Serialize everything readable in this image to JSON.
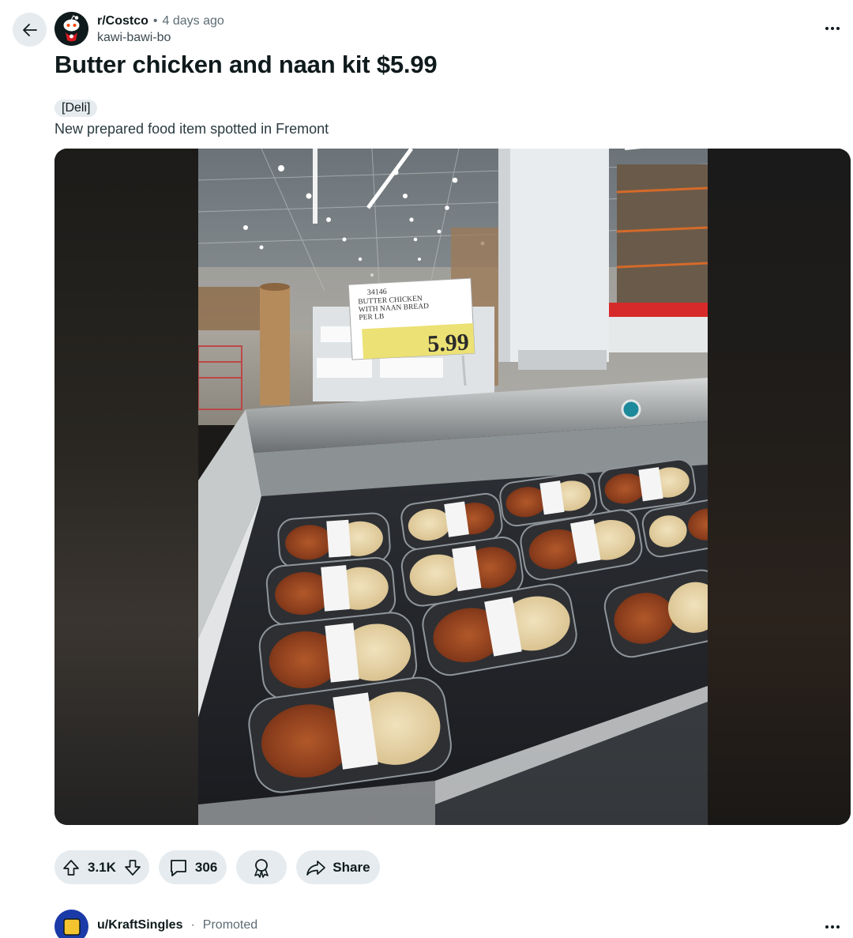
{
  "post": {
    "subreddit": "r/Costco",
    "separator": "•",
    "time_ago": "4 days ago",
    "author": "kawi-bawi-bo",
    "title": "Butter chicken and naan kit $5.99",
    "flair": "[Deli]",
    "body": "New prepared food item spotted in Fremont"
  },
  "media": {
    "sign_item_number": "34146",
    "sign_line1": "BUTTER CHICKEN",
    "sign_line2": "WITH NAAN BREAD",
    "sign_line3": "PER LB",
    "sign_price": "5.99"
  },
  "actions": {
    "votes": "3.1K",
    "comments": "306",
    "share_label": "Share"
  },
  "promoted": {
    "user": "u/KraftSingles",
    "separator": "·",
    "label": "Promoted"
  },
  "icons": {
    "back": "arrow-left-icon",
    "more": "more-horizontal-icon",
    "upvote": "upvote-arrow-icon",
    "downvote": "downvote-arrow-icon",
    "comment": "comment-bubble-icon",
    "award": "award-icon",
    "share": "share-arrow-icon"
  }
}
